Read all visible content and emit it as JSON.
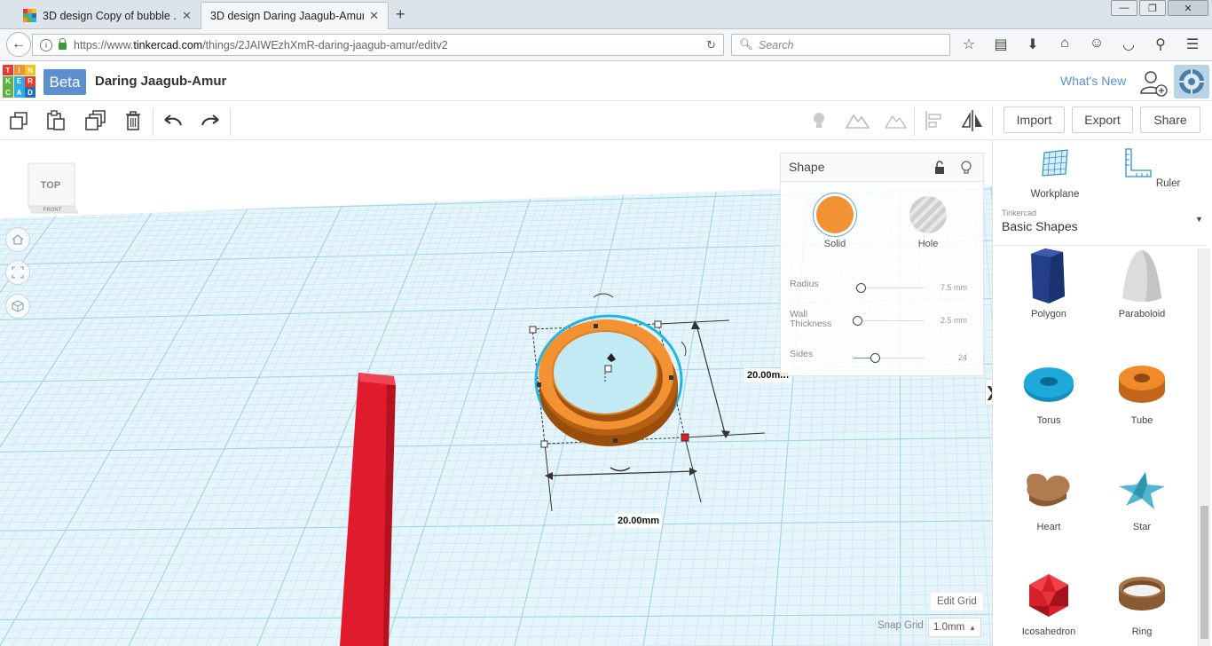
{
  "browser": {
    "tabs": [
      {
        "title": "3D design Copy of bubble ...",
        "active": false
      },
      {
        "title": "3D design Daring Jaagub-Amur...",
        "active": true
      }
    ],
    "new_tab": "+",
    "url_domain_prefix": "https://www.",
    "url_domain": "tinkercad.com",
    "url_path": "/things/2JAIWEzhXmR-daring-jaagub-amur/editv2",
    "search_placeholder": "Search"
  },
  "header": {
    "logo_letters": [
      "T",
      "I",
      "N",
      "K",
      "E",
      "R",
      "C",
      "A",
      "D"
    ],
    "beta": "Beta",
    "design_name": "Daring Jaagub-Amur",
    "whats_new": "What's New"
  },
  "toolbar": {
    "import": "Import",
    "export": "Export",
    "share": "Share"
  },
  "viewcube": {
    "top": "TOP",
    "front": "FRONT"
  },
  "shape_panel": {
    "title": "Shape",
    "solid": "Solid",
    "hole": "Hole",
    "solid_color": "#f39233",
    "params": [
      {
        "label": "Radius",
        "value": "7.5 mm",
        "level": 0.08
      },
      {
        "label": "Wall Thickness",
        "value": "2.5 mm",
        "level": 0.04
      },
      {
        "label": "Sides",
        "value": "24",
        "level": 0.3
      }
    ]
  },
  "dimensions": {
    "width": "20.00mm",
    "depth": "20.00mm"
  },
  "workplane": {
    "edit_grid": "Edit Grid",
    "snap_grid_label": "Snap Grid",
    "snap_grid_value": "1.0mm"
  },
  "sidebar": {
    "workplane": "Workplane",
    "ruler": "Ruler",
    "category_small": "Tinkercad",
    "category": "Basic Shapes",
    "shapes": [
      {
        "name": "Polygon"
      },
      {
        "name": "Paraboloid"
      },
      {
        "name": "Torus"
      },
      {
        "name": "Tube"
      },
      {
        "name": "Heart"
      },
      {
        "name": "Star"
      },
      {
        "name": "Icosahedron"
      },
      {
        "name": "Ring"
      }
    ]
  },
  "colors": {
    "accent": "#5b8fcf",
    "orange": "#f39233",
    "red_box": "#e01b2d",
    "grid": "#c7e5f0",
    "selection": "#20b6e3"
  }
}
